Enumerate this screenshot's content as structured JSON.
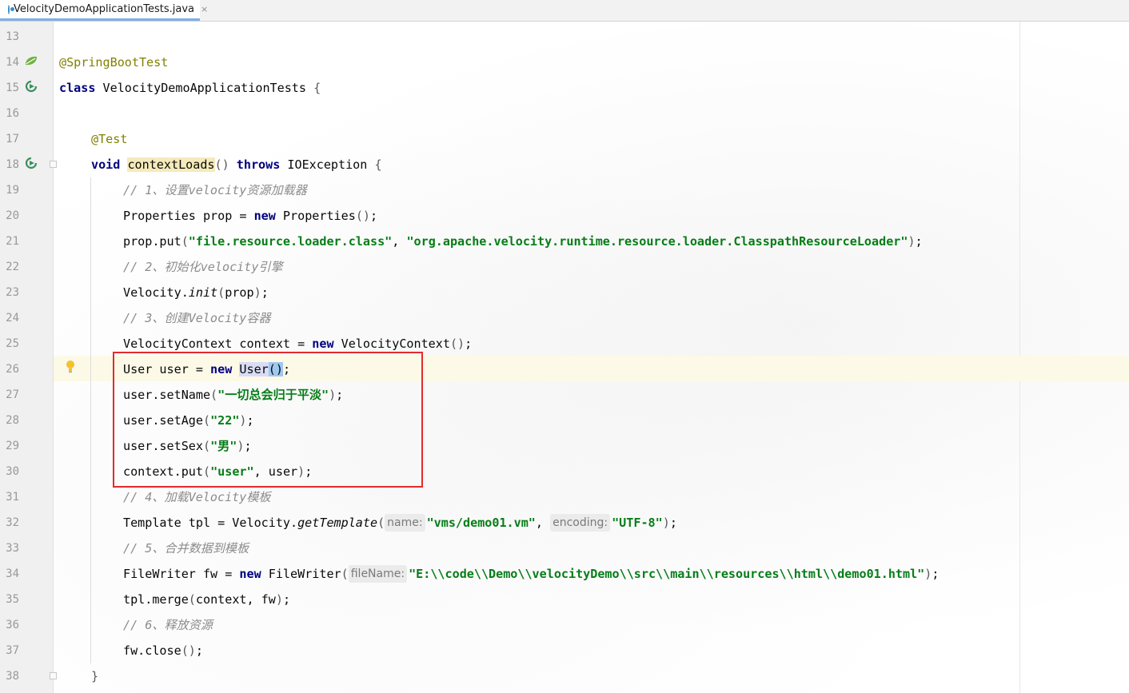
{
  "tab": {
    "title": "VelocityDemoApplicationTests.java",
    "close": "×"
  },
  "lines": {
    "l13": "13",
    "l14": "14",
    "l15": "15",
    "l16": "16",
    "l17": "17",
    "l18": "18",
    "l19": "19",
    "l20": "20",
    "l21": "21",
    "l22": "22",
    "l23": "23",
    "l24": "24",
    "l25": "25",
    "l26": "26",
    "l27": "27",
    "l28": "28",
    "l29": "29",
    "l30": "30",
    "l31": "31",
    "l32": "32",
    "l33": "33",
    "l34": "34",
    "l35": "35",
    "l36": "36",
    "l37": "37",
    "l38": "38"
  },
  "code": {
    "annSpring": "@SpringBootTest",
    "kwClass": "class",
    "className": " VelocityDemoApplicationTests ",
    "lbrace": "{",
    "annTest": "@Test",
    "kwVoid": "void",
    "sp": " ",
    "methodName": "contextLoads",
    "emptyParens": "()",
    "kwThrows": "throws",
    "ioException": " IOException ",
    "c1": "// 1、设置velocity资源加载器",
    "propDecl": "Properties prop = ",
    "kwNew": "new",
    "propCtor": " Properties",
    "semi": ";",
    "propPut": "prop.put",
    "lparen": "(",
    "rparen": ")",
    "strKey": "\"file.resource.loader.class\"",
    "comma": ", ",
    "strLoader": "\"org.apache.velocity.runtime.resource.loader.ClasspathResourceLoader\"",
    "c2": "// 2、初始化velocity引擎",
    "velocityDot": "Velocity.",
    "initName": "init",
    "propArg": "prop",
    "c3": "// 3、创建Velocity容器",
    "ctxDecl": "VelocityContext context = ",
    "ctxCtor": " VelocityContext",
    "userDecl": "User user = ",
    "userType": "User",
    "setName": "user.setName",
    "strName": "\"一切总会归于平淡\"",
    "setAge": "user.setAge",
    "strAge": "\"22\"",
    "setSex": "user.setSex",
    "strSex": "\"男\"",
    "ctxPut": "context.put",
    "strUser": "\"user\"",
    "userArg": "user",
    "c4": "// 4、加载Velocity模板",
    "tplDecl": "Template tpl = Velocity.",
    "getTemplate": "getTemplate",
    "hintName": "name:",
    "strVm": "\"vms/demo01.vm\"",
    "hintEncoding": "encoding:",
    "strUtf": "\"UTF-8\"",
    "c5": "// 5、合并数据到模板",
    "fwDecl": "FileWriter fw = ",
    "fwCtor": " FileWriter",
    "hintFileName": "fileName:",
    "strPath": "\"E:\\\\code\\\\Demo\\\\velocityDemo\\\\src\\\\main\\\\resources\\\\html\\\\demo01.html\"",
    "tplMerge": "tpl.merge",
    "mergeArgs": "context, fw",
    "c6": "// 6、释放资源",
    "fwClose": "fw.close",
    "rbrace": "}"
  },
  "icons": {
    "bean": "spring-bean-icon",
    "run": "run-test-icon",
    "bulb": "intention-bulb-icon",
    "fold": "fold-marker-icon"
  },
  "colors": {
    "keyword": "#000080",
    "annotation": "#808000",
    "string": "#067d17",
    "comment": "#8c8c8c",
    "highlightBox": "#e32b2b",
    "caretRow": "#fcf9e6"
  }
}
